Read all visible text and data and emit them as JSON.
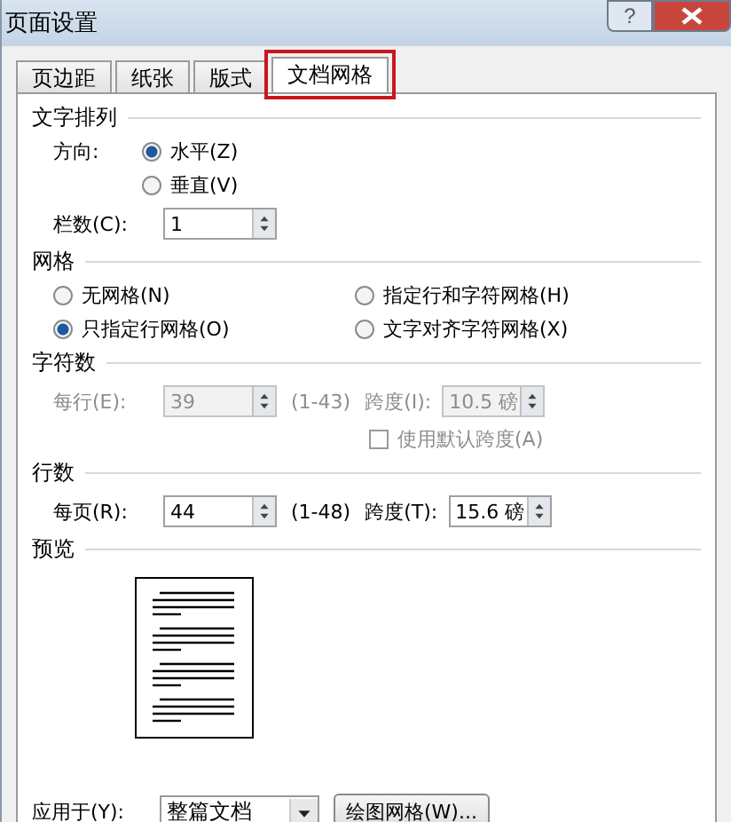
{
  "window": {
    "title": "页面设置",
    "help": "?"
  },
  "tabs": [
    {
      "label": "页边距",
      "selected": false,
      "highlighted": false
    },
    {
      "label": "纸张",
      "selected": false,
      "highlighted": false
    },
    {
      "label": "版式",
      "selected": false,
      "highlighted": false
    },
    {
      "label": "文档网格",
      "selected": true,
      "highlighted": true
    }
  ],
  "text_direction": {
    "heading": "文字排列",
    "label": "方向:",
    "options": [
      {
        "label": "水平(Z)",
        "selected": true
      },
      {
        "label": "垂直(V)",
        "selected": false
      }
    ],
    "columns_label": "栏数(C):",
    "columns_value": "1"
  },
  "grid": {
    "heading": "网格",
    "options": [
      {
        "label": "无网格(N)",
        "selected": false
      },
      {
        "label": "指定行和字符网格(H)",
        "selected": false
      },
      {
        "label": "只指定行网格(O)",
        "selected": true
      },
      {
        "label": "文字对齐字符网格(X)",
        "selected": false
      }
    ]
  },
  "characters": {
    "heading": "字符数",
    "disabled": true,
    "count_label": "每行(E):",
    "count_value": "39",
    "range": "(1-43)",
    "pitch_label": "跨度(I):",
    "pitch_value": "10.5 磅",
    "default_pitch": {
      "label": "使用默认跨度(A)",
      "checked": false
    }
  },
  "lines": {
    "heading": "行数",
    "disabled": false,
    "count_label": "每页(R):",
    "count_value": "44",
    "range": "(1-48)",
    "pitch_label": "跨度(T):",
    "pitch_value": "15.6 磅"
  },
  "preview": {
    "heading": "预览"
  },
  "apply_to": {
    "label": "应用于(Y):",
    "value": "整篇文档"
  },
  "buttons": [
    "绘图网格(W)..."
  ]
}
